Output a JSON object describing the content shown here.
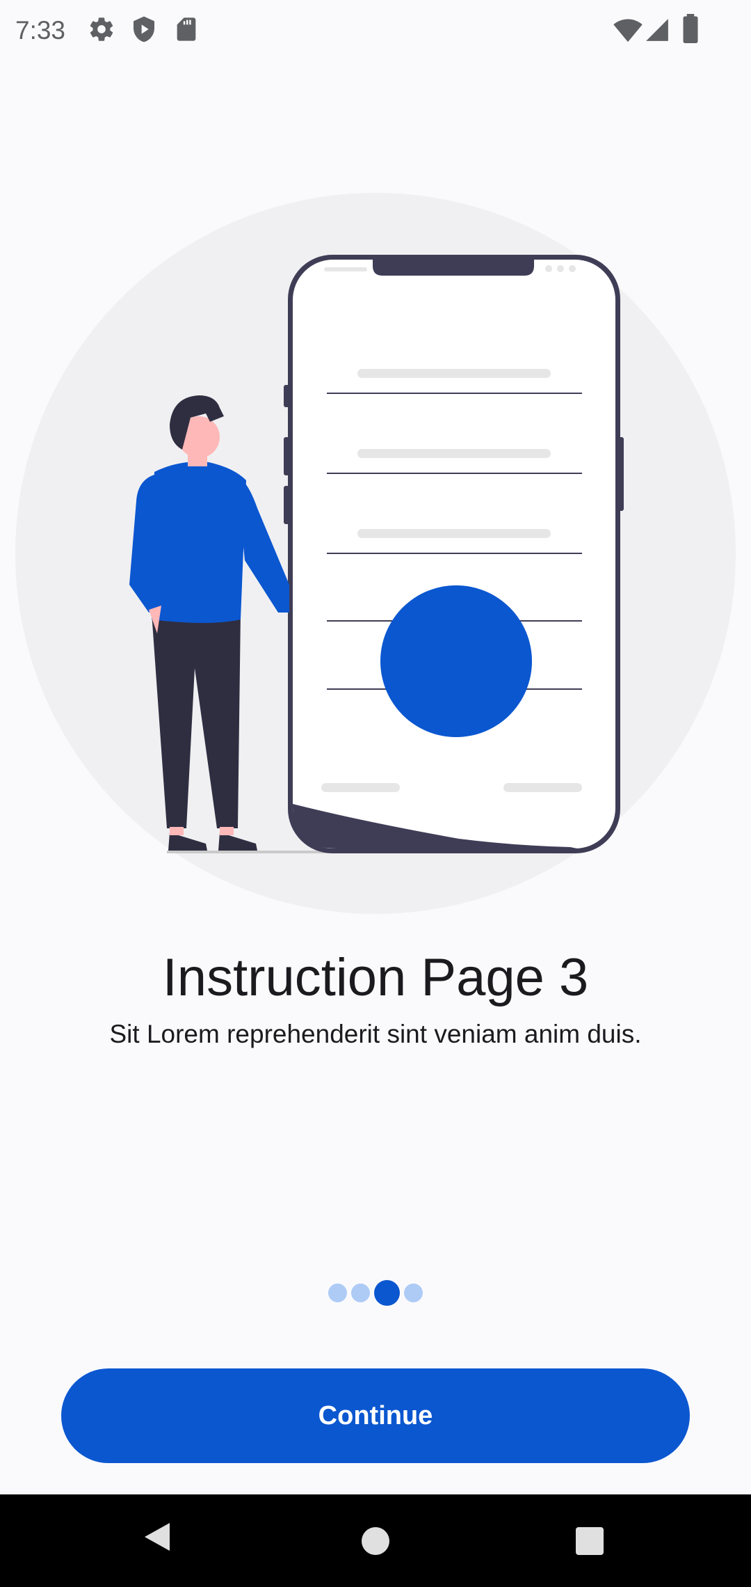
{
  "status_bar": {
    "time": "7:33",
    "left_icons": [
      "gear-icon",
      "shield-play-icon",
      "sd-card-icon"
    ],
    "right_icons": [
      "wifi-icon",
      "signal-icon",
      "battery-icon"
    ]
  },
  "onboarding": {
    "title": "Instruction Page 3",
    "subtitle": "Sit Lorem reprehenderit sint veniam anim duis.",
    "page_indicator": {
      "total": 4,
      "active_index": 2
    },
    "continue_label": "Continue"
  },
  "nav_bar": {
    "buttons": [
      "back-icon",
      "home-icon",
      "recents-icon"
    ]
  },
  "colors": {
    "accent": "#0b57d0",
    "dot_inactive": "#aecbf6",
    "background": "#fafafd",
    "text": "#1b1b1f",
    "illustration_circle": "#f0f0f2",
    "phone_frame": "#3f3d56"
  }
}
